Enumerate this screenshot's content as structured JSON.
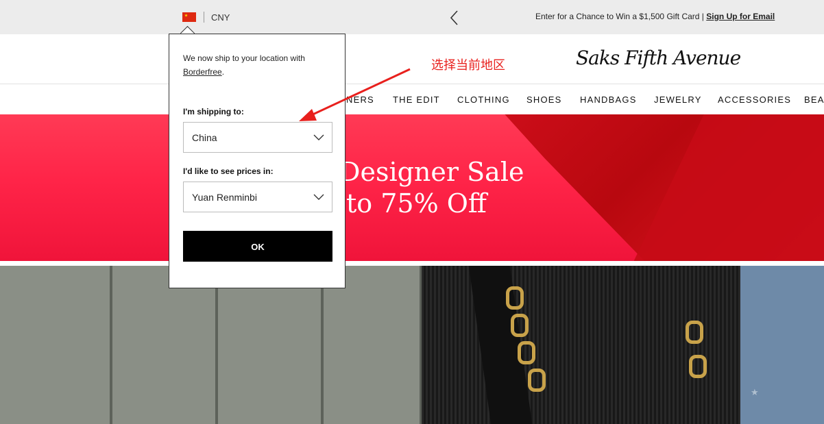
{
  "topbar": {
    "currency": "CNY",
    "promo_text": "Enter for a Chance to Win a $1,500 Gift Card | ",
    "promo_link": "Sign Up for Email"
  },
  "header": {
    "annotation": "选择当前地区",
    "logo": "Saks Fifth Avenue"
  },
  "nav": {
    "items": [
      "NERS",
      "THE EDIT",
      "CLOTHING",
      "SHOES",
      "HANDBAGS",
      "JEWELRY",
      "ACCESSORIES",
      "BEA"
    ]
  },
  "hero": {
    "title": "Designer Sale",
    "subtitle": "to 75% Off"
  },
  "popup": {
    "message": "We now ship to your location with ",
    "message_link": "Borderfree",
    "message_end": ".",
    "shipping_label": "I'm shipping to:",
    "shipping_value": "China",
    "prices_label": "I'd like to see prices in:",
    "prices_value": "Yuan Renminbi",
    "ok_label": "OK"
  },
  "colors": {
    "hero_red": "#ff2448",
    "annotation_red": "#e8201d",
    "button_black": "#000000"
  }
}
